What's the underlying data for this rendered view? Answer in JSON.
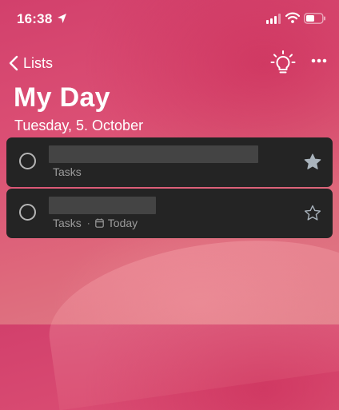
{
  "status_bar": {
    "time": "16:38"
  },
  "nav": {
    "back_label": "Lists"
  },
  "header": {
    "title": "My Day",
    "date": "Tuesday, 5. October"
  },
  "tasks": [
    {
      "title": "",
      "list": "Tasks",
      "due": "",
      "important": true
    },
    {
      "title": "",
      "list": "Tasks",
      "due": "Today",
      "important": false
    }
  ],
  "colors": {
    "background_accent": "#d84a70",
    "card": "#242424",
    "meta_text": "#9b9b9b",
    "star": "#a9b3bc"
  }
}
